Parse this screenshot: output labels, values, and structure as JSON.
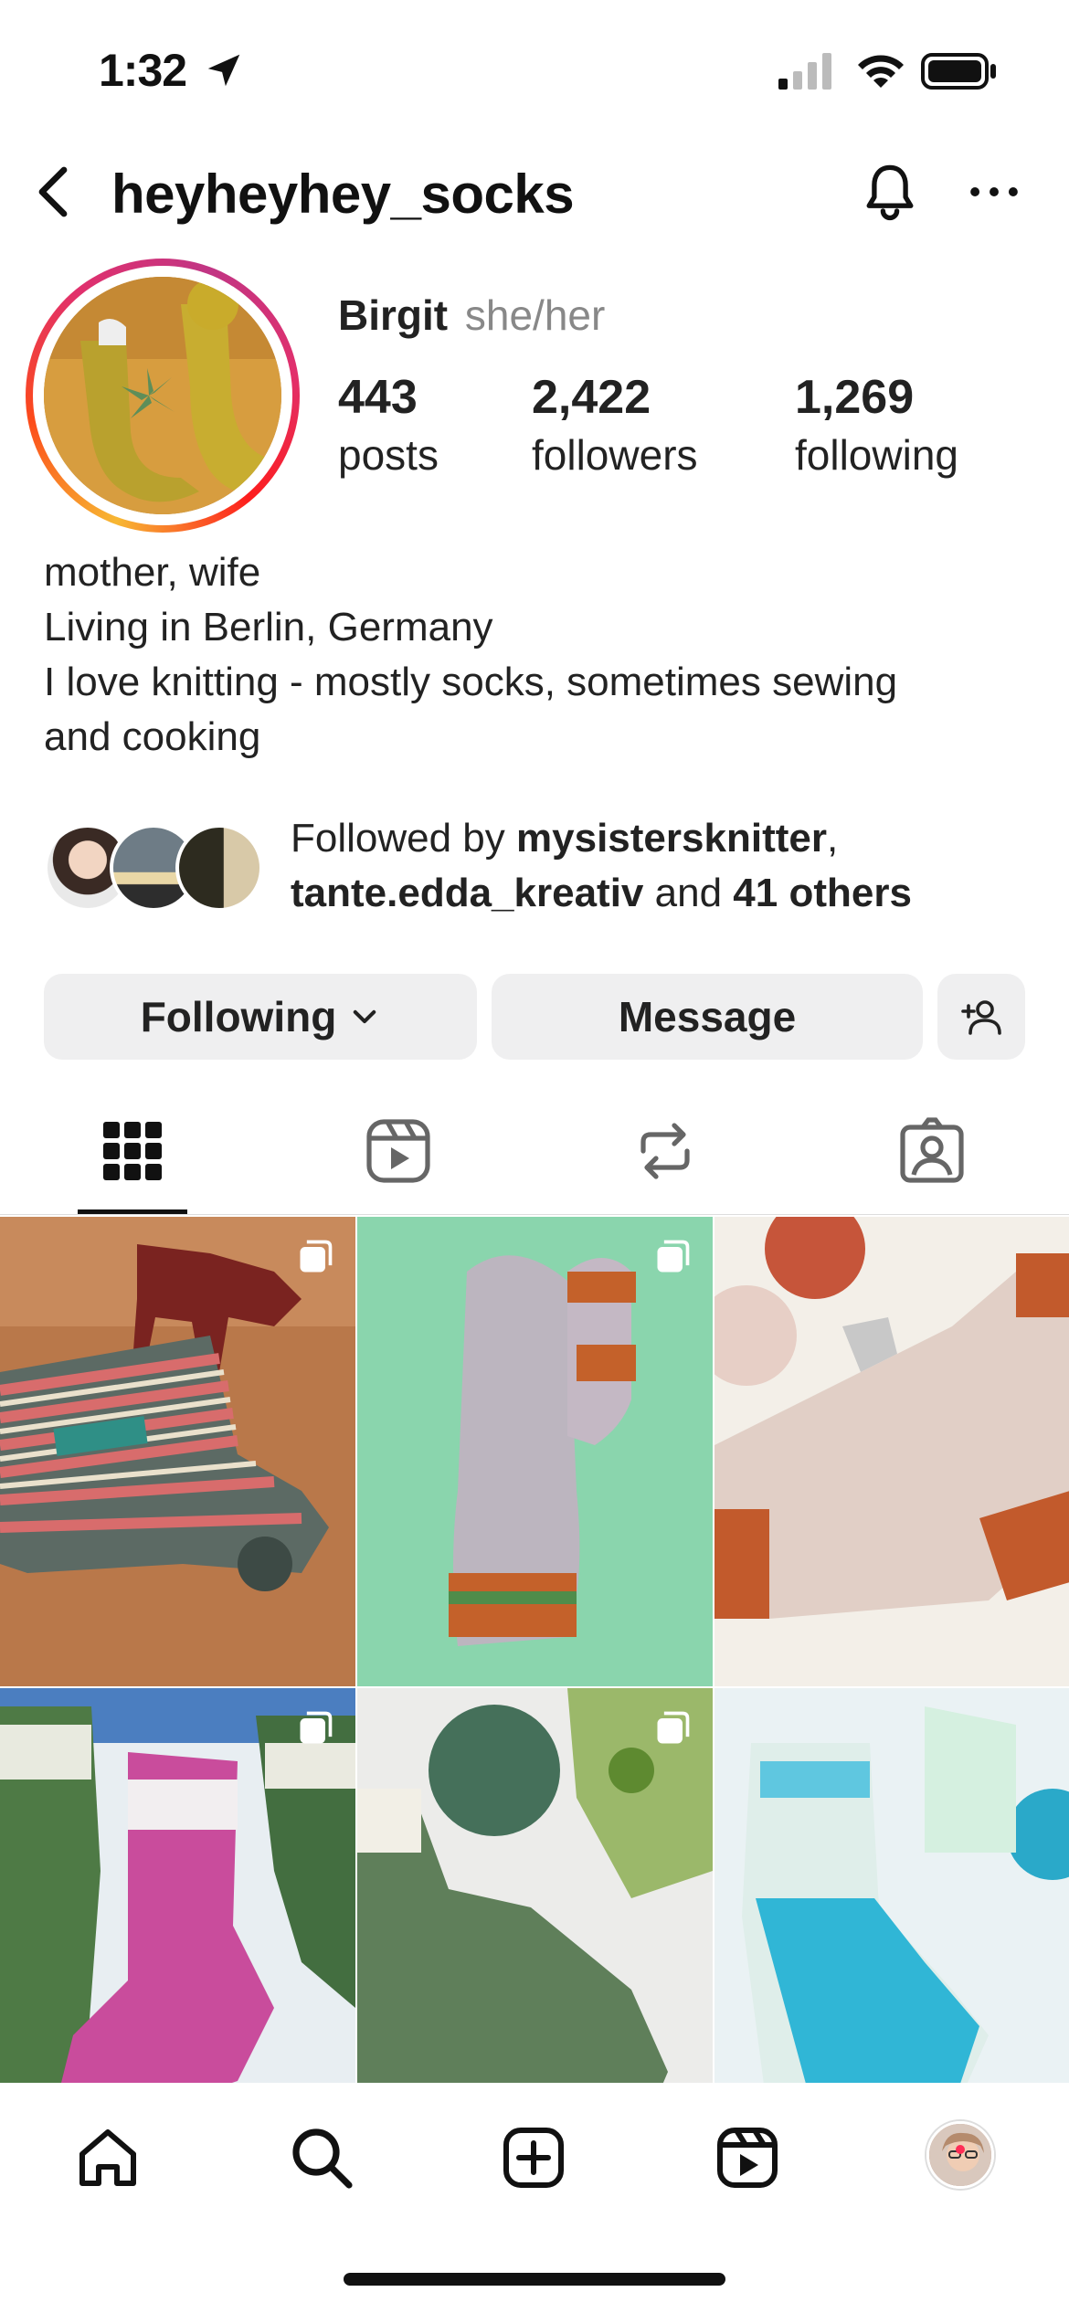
{
  "status_bar": {
    "time": "1:32"
  },
  "header": {
    "username": "heyheyhey_socks"
  },
  "profile": {
    "name": "Birgit",
    "pronouns": "she/her",
    "stats": [
      {
        "value": "443",
        "label": "posts"
      },
      {
        "value": "2,422",
        "label": "followers"
      },
      {
        "value": "1,269",
        "label": "following"
      }
    ],
    "bio": [
      "mother, wife",
      "Living in Berlin, Germany",
      "I love knitting - mostly socks, sometimes sewing",
      "and cooking"
    ]
  },
  "followed_by": {
    "prefix": "Followed by",
    "user1": "mysistersknitter",
    "separator": ",",
    "user2": "tante.edda_kreativ",
    "and": "and",
    "others": "41 others"
  },
  "actions": {
    "following_label": "Following",
    "message_label": "Message"
  },
  "tabs": [
    "grid",
    "reels",
    "reposts",
    "tagged"
  ],
  "active_tab": "grid",
  "posts": [
    {
      "icon": "multi-photo-icon",
      "colors": [
        "#b5784a",
        "#2f6a5d",
        "#c44f4f"
      ]
    },
    {
      "icon": "multi-photo-icon",
      "colors": [
        "#7fcfa4",
        "#bcb5bf",
        "#c4612a"
      ]
    },
    {
      "icon": "",
      "colors": [
        "#f3efe8",
        "#e7cfc6",
        "#c25a2c"
      ]
    },
    {
      "icon": "multi-photo-icon",
      "colors": [
        "#c94c9c",
        "#3e6e3a",
        "#f0f0f0"
      ]
    },
    {
      "icon": "multi-photo-icon",
      "colors": [
        "#5f7f5a",
        "#9bb86a",
        "#e9e9e9"
      ]
    },
    {
      "icon": "",
      "colors": [
        "#eaf2f4",
        "#30b6d6",
        "#dfeeea"
      ]
    }
  ],
  "colors": {
    "accent_ring_start": "#f7b733",
    "accent_ring_end": "#c13584",
    "notification_dot": "#ff2d55"
  }
}
